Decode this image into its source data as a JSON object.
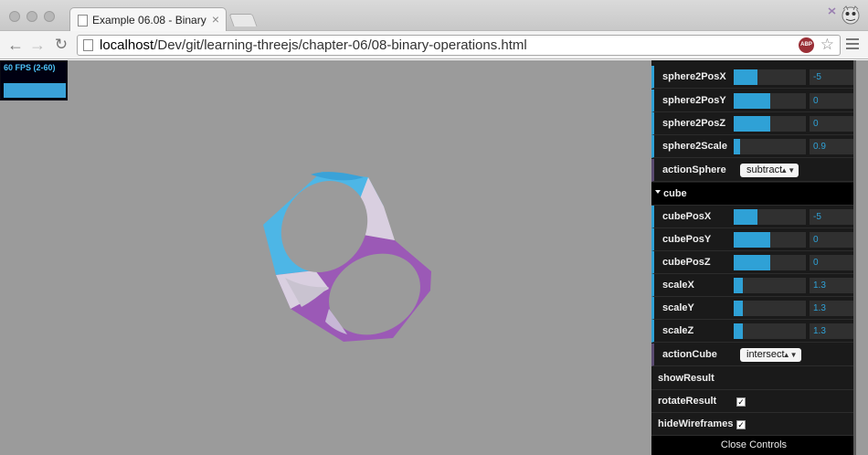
{
  "browser": {
    "tab_title": "Example 06.08 - Binary operations",
    "tab_close": "×",
    "url_host": "localhost",
    "url_path": "/Dev/git/learning-threejs/chapter-06/08-binary-operations.html",
    "abp_label": "ABP",
    "back_icon": "arrow-left-icon",
    "forward_icon": "arrow-right-icon",
    "reload_icon": "reload-icon"
  },
  "stats": {
    "fps_text": "60 FPS (2-60)"
  },
  "gui": {
    "rows": [
      {
        "label": "sphere2PosX",
        "value": "-5",
        "fill": 0.33
      },
      {
        "label": "sphere2PosY",
        "value": "0",
        "fill": 0.5
      },
      {
        "label": "sphere2PosZ",
        "value": "0",
        "fill": 0.5
      },
      {
        "label": "sphere2Scale",
        "value": "0.9",
        "fill": 0.09
      }
    ],
    "action_sphere": {
      "label": "actionSphere",
      "value": "subtract"
    },
    "cube_folder": "cube",
    "cube_rows": [
      {
        "label": "cubePosX",
        "value": "-5",
        "fill": 0.33
      },
      {
        "label": "cubePosY",
        "value": "0",
        "fill": 0.5
      },
      {
        "label": "cubePosZ",
        "value": "0",
        "fill": 0.5
      },
      {
        "label": "scaleX",
        "value": "1.3",
        "fill": 0.13
      },
      {
        "label": "scaleY",
        "value": "1.3",
        "fill": 0.13
      },
      {
        "label": "scaleZ",
        "value": "1.3",
        "fill": 0.13
      }
    ],
    "action_cube": {
      "label": "actionCube",
      "value": "intersect"
    },
    "show_result": "showResult",
    "rotate_result": {
      "label": "rotateResult",
      "checked": "✓"
    },
    "hide_wireframes": {
      "label": "hideWireframes",
      "checked": "✓"
    },
    "close_controls": "Close Controls"
  },
  "colors": {
    "accent": "#2fa1d6",
    "viewport_bg": "#9b9b9b",
    "mesh_blue": "#4db6e6",
    "mesh_purple": "#9b59b6",
    "mesh_inner": "#d9cfe0"
  }
}
